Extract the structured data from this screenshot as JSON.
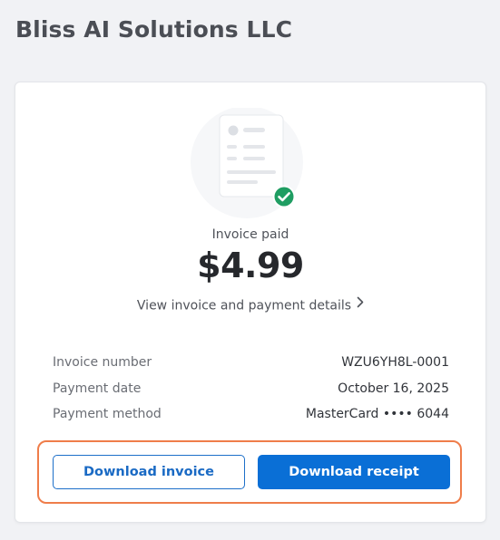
{
  "merchant": {
    "name": "Bliss AI Solutions LLC"
  },
  "invoice": {
    "status_label": "Invoice paid",
    "status_icon": "check-circle-icon",
    "amount": "$4.99",
    "view_details_label": "View invoice and payment details"
  },
  "details": [
    {
      "label": "Invoice number",
      "value": "WZU6YH8L-0001"
    },
    {
      "label": "Payment date",
      "value": "October 16, 2025"
    },
    {
      "label": "Payment method",
      "value": "MasterCard •••• 6044"
    }
  ],
  "actions": {
    "download_invoice_label": "Download invoice",
    "download_receipt_label": "Download receipt"
  },
  "colors": {
    "primary": "#0a6fd6",
    "success": "#1f9d62",
    "highlight": "#ef7d4a",
    "background": "#f1f2f5"
  }
}
